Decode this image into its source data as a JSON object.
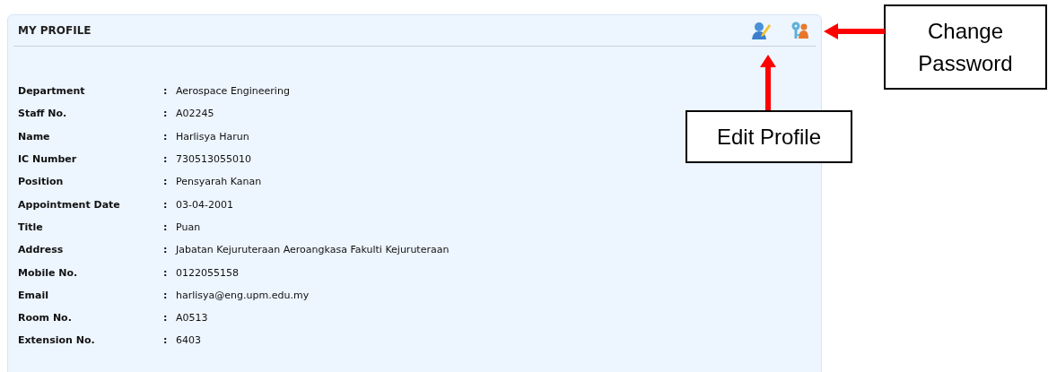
{
  "panel": {
    "title": "MY PROFILE"
  },
  "fields": [
    {
      "label": "Department",
      "separator": ":",
      "value": "Aerospace Engineering"
    },
    {
      "label": "Staff No.",
      "separator": ":",
      "value": "A02245"
    },
    {
      "label": "Name",
      "separator": ":",
      "value": "Harlisya Harun"
    },
    {
      "label": "IC Number",
      "separator": ":",
      "value": "730513055010"
    },
    {
      "label": "Position",
      "separator": ":",
      "value": "Pensyarah Kanan"
    },
    {
      "label": "Appointment Date",
      "separator": ":",
      "value": "03-04-2001"
    },
    {
      "label": "Title",
      "separator": ":",
      "value": "Puan"
    },
    {
      "label": "Address",
      "separator": ":",
      "value": "Jabatan Kejuruteraan Aeroangkasa Fakulti Kejuruteraan"
    },
    {
      "label": "Mobile No.",
      "separator": ":",
      "value": "0122055158"
    },
    {
      "label": "Email",
      "separator": ":",
      "value": "harlisya@eng.upm.edu.my"
    },
    {
      "label": "Room No.",
      "separator": ":",
      "value": "A0513"
    },
    {
      "label": "Extension No.",
      "separator": ":",
      "value": "6403"
    }
  ],
  "callouts": [
    {
      "kind": "left",
      "text": "Change Password"
    },
    {
      "kind": "up",
      "text": "Edit Profile"
    }
  ]
}
